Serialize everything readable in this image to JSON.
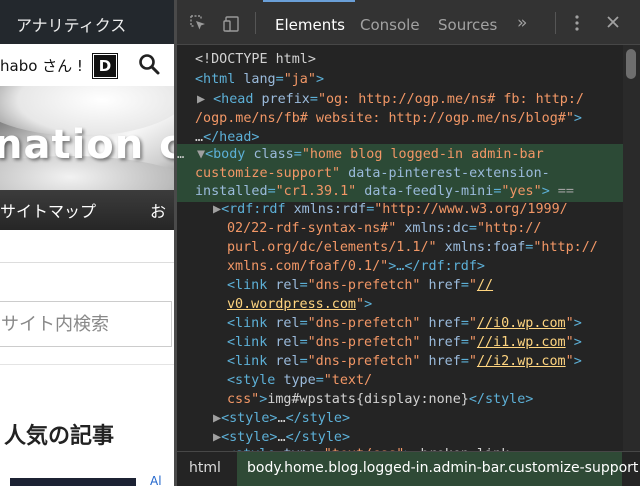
{
  "page": {
    "admin_title": "アナリティクス",
    "greeting": "habo さん !",
    "greeting_badge": "D",
    "banner_text": "nation c",
    "nav_item_1": "サイトマップ",
    "nav_item_2": "お",
    "search_placeholder": "サイト内検索",
    "popular_heading": "人気の記事",
    "thumb_link": "Al"
  },
  "devtools": {
    "tabs": [
      {
        "label": "Elements",
        "active": true
      },
      {
        "label": "Console",
        "active": false
      },
      {
        "label": "Sources",
        "active": false
      }
    ],
    "more_tabs": "»",
    "icons": [
      "inspect-icon",
      "device-mode-icon",
      "more-icon",
      "close-icon"
    ],
    "code": {
      "l1": "<!DOCTYPE html>",
      "l2": {
        "open": "<html ",
        "attr": "lang",
        "eq": "=",
        "val": "\"ja\"",
        "close": ">"
      },
      "l3": {
        "tri": "▶",
        "open": "<head ",
        "attr": "prefix",
        "eq": "=",
        "val": "\"og: http://ogp.me/ns# fb: http:/"
      },
      "l4": {
        "val": "/ogp.me/ns/fb# website: http://ogp.me/ns/blog#\"",
        "close": ">"
      },
      "l5": {
        "ell": "…",
        "close": "</head>"
      },
      "l6": {
        "dots": "…",
        "tri": "▼",
        "open": "<body ",
        "attr": "class",
        "eq": "=",
        "val": "\"home blog logged-in admin-bar"
      },
      "l7": {
        "val": "customize-support\"",
        "attr": " data-pinterest-extension-"
      },
      "l8": {
        "attr": "installed",
        "eq": "=",
        "val": "\"cr1.39.1\"",
        "attr2": " data-feedly-mini",
        "eq2": "=",
        "val2": "\"yes\"",
        "close": ">",
        "marker": " =="
      },
      "l9": {
        "tri": "▶",
        "open": "<rdf:rdf ",
        "attr": "xmlns:rdf",
        "eq": "=",
        "val": "\"http://www.w3.org/1999/"
      },
      "l10": {
        "val": "02/22-rdf-syntax-ns#\"",
        "attr": " xmlns:dc",
        "eq": "=",
        "val2": "\"http://"
      },
      "l11": {
        "val": "purl.org/dc/elements/1.1/\"",
        "attr": " xmlns:foaf",
        "eq": "=",
        "val2": "\"http://"
      },
      "l12": {
        "val": "xmlns.com/foaf/0.1/\"",
        "close": ">…</rdf:rdf>"
      },
      "l13": {
        "open": "<link ",
        "attr": "rel",
        "eq": "=",
        "val": "\"dns-prefetch\"",
        "attr2": " href",
        "eq2": "=",
        "q": "\"",
        "url": "//"
      },
      "l14": {
        "url": "v0.wordpress.com",
        "q": "\"",
        "close": ">"
      },
      "l15": {
        "open": "<link ",
        "attr": "rel",
        "eq": "=",
        "val": "\"dns-prefetch\"",
        "attr2": " href",
        "eq2": "=",
        "q": "\"",
        "url": "//i0.wp.com",
        "q2": "\"",
        "close": ">"
      },
      "l16": {
        "open": "<link ",
        "attr": "rel",
        "eq": "=",
        "val": "\"dns-prefetch\"",
        "attr2": " href",
        "eq2": "=",
        "q": "\"",
        "url": "//i1.wp.com",
        "q2": "\"",
        "close": ">"
      },
      "l17": {
        "open": "<link ",
        "attr": "rel",
        "eq": "=",
        "val": "\"dns-prefetch\"",
        "attr2": " href",
        "eq2": "=",
        "q": "\"",
        "url": "//i2.wp.com",
        "q2": "\"",
        "close": ">"
      },
      "l18": {
        "open": "<style ",
        "attr": "type",
        "eq": "=",
        "val": "\"text/"
      },
      "l19": {
        "val": "css\"",
        "close": ">",
        "text": "img#wpstats{display:none}",
        "end": "</style>"
      },
      "l20": {
        "tri": "▶",
        "open": "<style>",
        "ell": "…",
        "close": "</style>"
      },
      "l21": {
        "tri": "▶",
        "open": "<style>",
        "ell": "…",
        "close": "</style>"
      },
      "l22": {
        "open": "<style ",
        "attr": "type",
        "eq": "=",
        "val": "\"text/css\"",
        "close": ">",
        "text": ".broken_link,"
      }
    },
    "breadcrumbs": [
      "html",
      "body.home.blog.logged-in.admin-bar.customize-support"
    ]
  },
  "colors": {
    "tag": "#5db0d7",
    "attr": "#9bbbdc",
    "value": "#f29766",
    "selection": "#2c4a36",
    "toolbar": "#333333",
    "panel": "#242424"
  }
}
